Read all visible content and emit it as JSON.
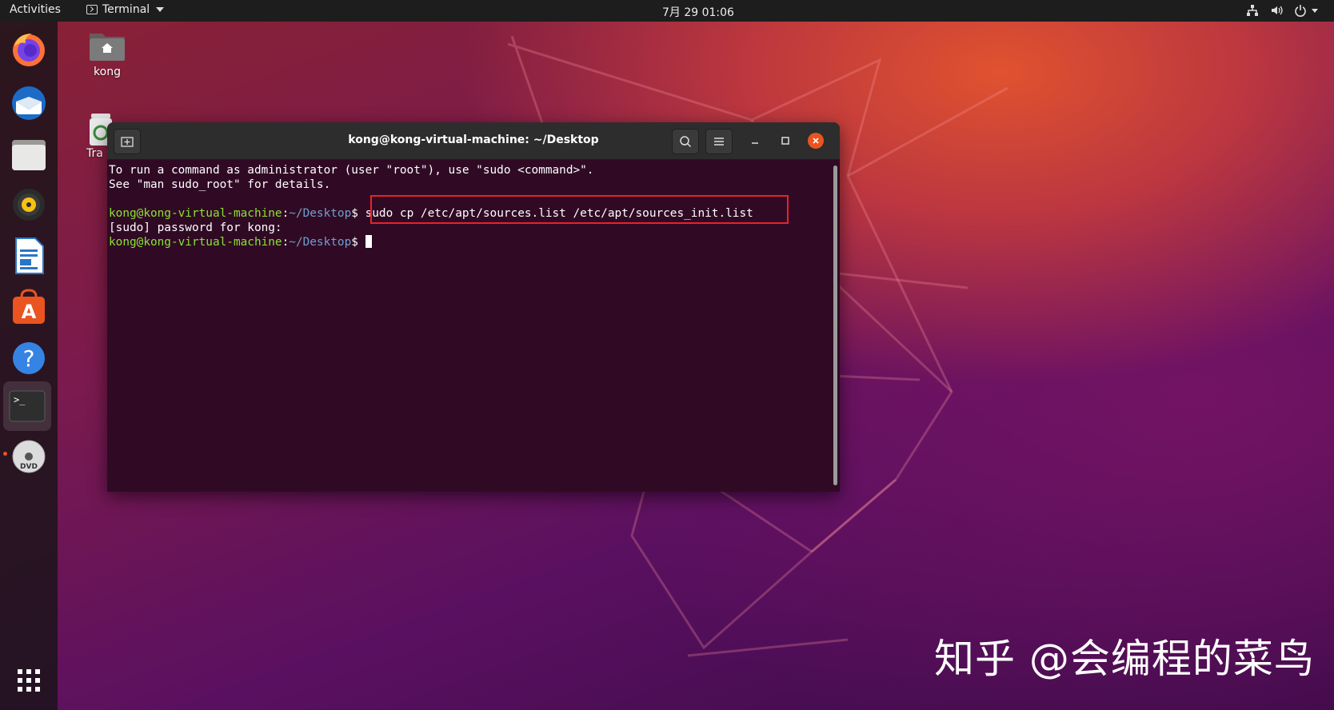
{
  "topbar": {
    "activities": "Activities",
    "app_name": "Terminal",
    "clock": "7月 29  01:06",
    "tray_icons": [
      "network-icon",
      "volume-icon",
      "power-icon"
    ]
  },
  "dock": {
    "items": [
      "firefox-icon",
      "thunderbird-icon",
      "files-icon",
      "rhythmbox-icon",
      "libreoffice-writer-icon",
      "ubuntu-software-icon",
      "help-icon",
      "terminal-icon",
      "dvd-icon",
      "show-apps-icon"
    ],
    "active": "terminal-icon"
  },
  "desktop": {
    "home_label": "kong",
    "trash_label": "Tra"
  },
  "terminal": {
    "title": "kong@kong-virtual-machine: ~/Desktop",
    "lines": [
      "To run a command as administrator (user \"root\"), use \"sudo <command>\".",
      "See \"man sudo_root\" for details."
    ],
    "prompt_user": "kong@kong-virtual-machine",
    "prompt_colon": ":",
    "prompt_path": "~/Desktop",
    "prompt_symbol": "$ ",
    "command": "sudo cp /etc/apt/sources.list /etc/apt/sources_init.list",
    "sudo_line": "[sudo] password for kong:",
    "colors": {
      "background": "#300a24",
      "user": "#8ae234",
      "path": "#729fcf",
      "highlight": "#e8222b"
    }
  },
  "watermark": "知乎 @会编程的菜鸟"
}
